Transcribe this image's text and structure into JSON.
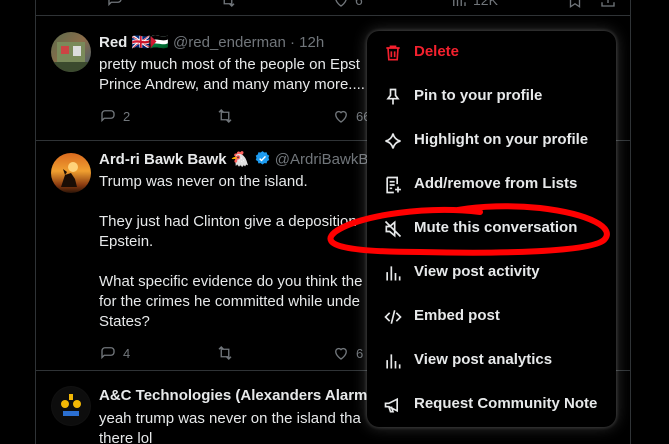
{
  "top_actions": {
    "likes": "6",
    "views": "12K"
  },
  "tweets": [
    {
      "name": "Red",
      "flags": "🇬🇧🇵🇸",
      "handle": "@red_enderman",
      "time": "· 12h",
      "text": "pretty much most of the people on Epst\nPrince Andrew, and many many more....",
      "replies": "2",
      "likes": "66"
    },
    {
      "name": "Ard-ri Bawk Bawk",
      "badge_emoji": "🐔",
      "handle": "@ArdriBawkB",
      "text": "Trump was never on the island.\n\nThey just had Clinton give a deposition\nEpstein.\n\nWhat specific evidence do you think the\nfor the crimes he committed while unde\nStates?",
      "replies": "4",
      "likes": "6"
    },
    {
      "name": "A&C Technologies (Alexanders Alarm",
      "text": "yeah trump was never on the island tha\nthere lol"
    }
  ],
  "menu": {
    "items": [
      {
        "label": "Delete",
        "icon": "trash-icon"
      },
      {
        "label": "Pin to your profile",
        "icon": "pin-icon"
      },
      {
        "label": "Highlight on your profile",
        "icon": "sparkle-icon"
      },
      {
        "label": "Add/remove from Lists",
        "icon": "list-icon"
      },
      {
        "label": "Mute this conversation",
        "icon": "mute-icon"
      },
      {
        "label": "View post activity",
        "icon": "bar-chart-icon"
      },
      {
        "label": "Embed post",
        "icon": "code-icon"
      },
      {
        "label": "View post analytics",
        "icon": "analytics-icon"
      },
      {
        "label": "Request Community Note",
        "icon": "megaphone-icon"
      }
    ]
  },
  "colors": {
    "danger": "#f4212e",
    "annotation": "#ff0000",
    "verified": "#1d9bf0"
  }
}
